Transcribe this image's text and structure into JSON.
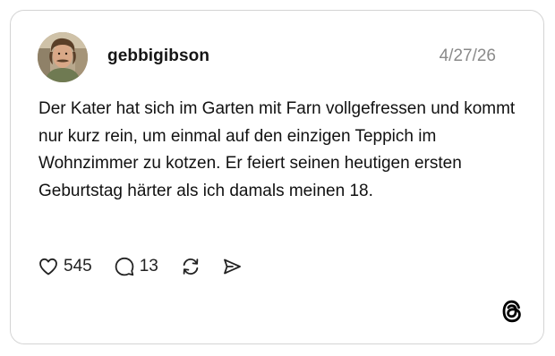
{
  "post": {
    "username": "gebbigibson",
    "date": "4/27/26",
    "text": "Der Kater hat sich im Garten mit Farn vollgefressen und kommt nur kurz rein, um einmal auf den einzigen Teppich im Wohnzimmer zu kotzen. Er feiert seinen heutigen ersten Geburtstag härter als ich damals meinen 18.",
    "likes": "545",
    "replies": "13"
  },
  "icons": {
    "like": "heart-icon",
    "reply": "comment-bubble-icon",
    "repost": "repost-icon",
    "share": "send-icon",
    "brand": "threads-logo-icon"
  },
  "colors": {
    "border": "#d4d4d4",
    "text": "#111111",
    "date": "#8a8a8a"
  }
}
